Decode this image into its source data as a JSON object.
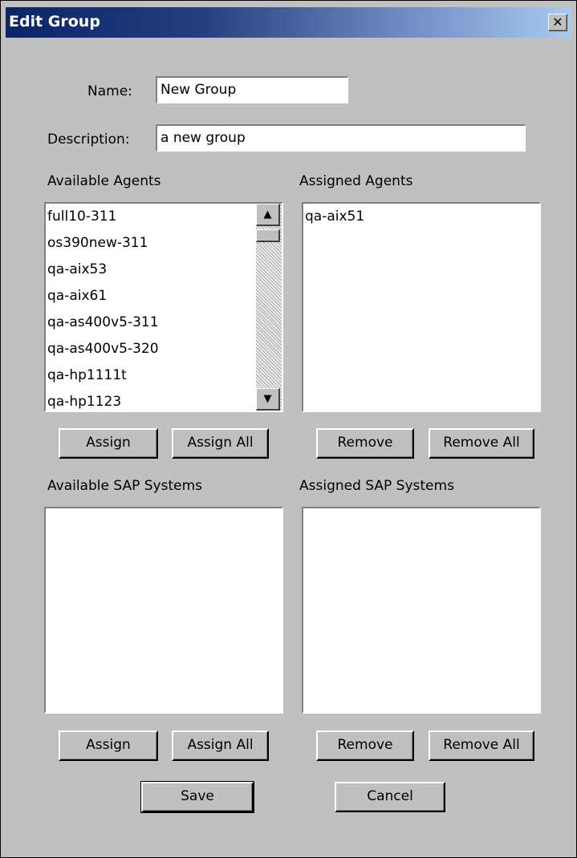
{
  "window": {
    "title": "Edit Group",
    "close_glyph": "✕"
  },
  "form": {
    "name_label": "Name:",
    "name_value": "New Group",
    "description_label": "Description:",
    "description_value": "a new group"
  },
  "agents": {
    "available_label": "Available Agents",
    "assigned_label": "Assigned Agents",
    "available": [
      "full10-311",
      "os390new-311",
      "qa-aix53",
      "qa-aix61",
      "qa-as400v5-311",
      "qa-as400v5-320",
      "qa-hp1111t",
      "qa-hp1123"
    ],
    "assigned": [
      "qa-aix51"
    ],
    "assign_label": "Assign",
    "assign_all_label": "Assign All",
    "remove_label": "Remove",
    "remove_all_label": "Remove All"
  },
  "sap": {
    "available_label": "Available SAP Systems",
    "assigned_label": "Assigned SAP Systems",
    "available": [],
    "assigned": [],
    "assign_label": "Assign",
    "assign_all_label": "Assign All",
    "remove_label": "Remove",
    "remove_all_label": "Remove All"
  },
  "footer": {
    "save_label": "Save",
    "cancel_label": "Cancel"
  },
  "icons": {
    "scroll_up": "arrow-up-icon",
    "scroll_down": "arrow-down-icon",
    "close": "close-icon"
  }
}
